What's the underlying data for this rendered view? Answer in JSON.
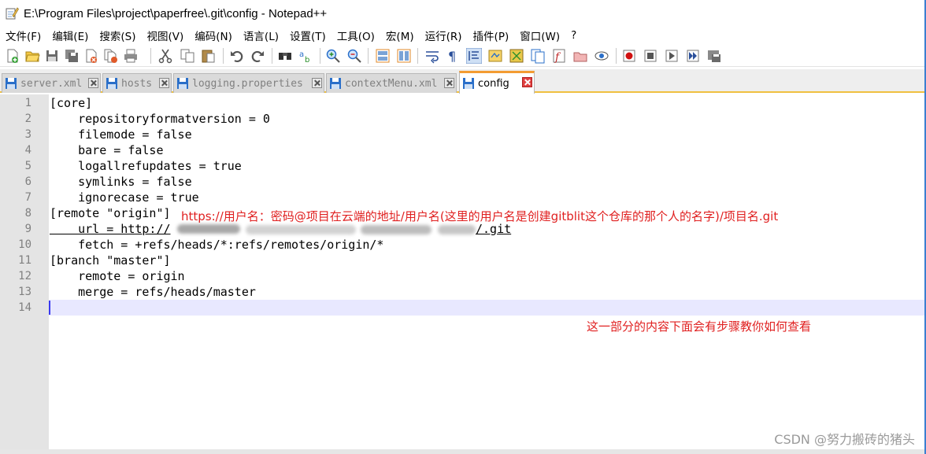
{
  "window": {
    "title": "E:\\Program Files\\project\\paperfree\\.git\\config - Notepad++",
    "app_icon": "notepad-icon"
  },
  "menu": [
    "文件(F)",
    "编辑(E)",
    "搜索(S)",
    "视图(V)",
    "编码(N)",
    "语言(L)",
    "设置(T)",
    "工具(O)",
    "宏(M)",
    "运行(R)",
    "插件(P)",
    "窗口(W)",
    "?"
  ],
  "toolbar": {
    "icons": [
      "new-file-icon",
      "open-file-icon",
      "save-icon",
      "save-all-icon",
      "close-icon",
      "close-all-icon",
      "print-icon",
      "cut-icon",
      "copy-icon",
      "paste-icon",
      "undo-icon",
      "redo-icon",
      "find-icon",
      "replace-icon",
      "zoom-in-icon",
      "zoom-out-icon",
      "sync-vertical-icon",
      "sync-horizontal-icon",
      "word-wrap-icon",
      "show-all-chars-icon",
      "indent-guide-icon",
      "udl-icon",
      "doc-map-icon",
      "doc-list-icon",
      "function-list-icon",
      "folder-workspace-icon",
      "monitoring-icon",
      "record-macro-icon",
      "stop-record-icon",
      "play-macro-icon",
      "run-macro-multiple-icon",
      "save-macro-icon"
    ]
  },
  "tabs": [
    {
      "label": "server.xml",
      "active": false
    },
    {
      "label": "hosts",
      "active": false
    },
    {
      "label": "logging.properties",
      "active": false
    },
    {
      "label": "contextMenu.xml",
      "active": false
    },
    {
      "label": "config",
      "active": true
    }
  ],
  "editor": {
    "line_numbers": [
      "1",
      "2",
      "3",
      "4",
      "5",
      "6",
      "7",
      "8",
      "9",
      "10",
      "11",
      "12",
      "13",
      "14"
    ],
    "lines": [
      "[core]",
      "    repositoryformatversion = 0",
      "    filemode = false",
      "    bare = false",
      "    logallrefupdates = true",
      "    symlinks = false",
      "    ignorecase = true",
      "[remote \"origin\"]",
      "    url = http://",
      "    fetch = +refs/heads/*:refs/remotes/origin/*",
      "[branch \"master\"]",
      "    remote = origin",
      "    merge = refs/heads/master",
      ""
    ],
    "url_tail": "/.git",
    "current_line": 14
  },
  "annotations": {
    "url_format": "https://用户名：密码@项目在云端的地址/用户名(这里的用户名是创建gitblit这个仓库的那个人的名字)/项目名.git",
    "note": "这一部分的内容下面会有步骤教你如何查看"
  },
  "watermark": "CSDN @努力搬砖的猪头",
  "colors": {
    "annotation": "#e02020",
    "active_tab_accent": "#f39c32",
    "current_line_bg": "#e8e8ff",
    "gutter_bg": "#e4e4e4"
  }
}
